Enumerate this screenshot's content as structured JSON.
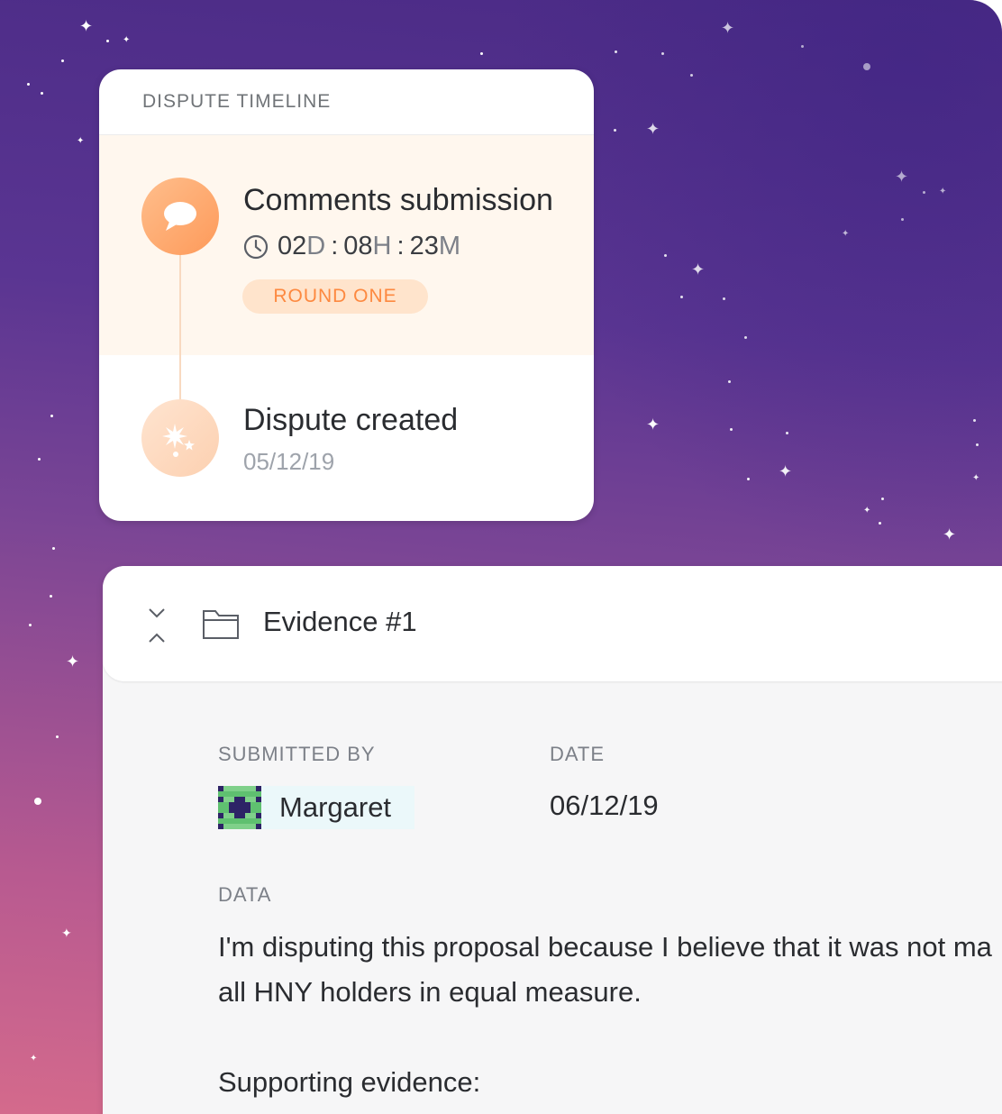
{
  "timeline": {
    "header": "DISPUTE TIMELINE",
    "active_step": {
      "title": "Comments submission",
      "icon": "speech-bubble-icon",
      "timer": {
        "days": "02",
        "days_unit": "D",
        "hours": "08",
        "hours_unit": "H",
        "minutes": "23",
        "minutes_unit": "M",
        "separator": ":"
      },
      "badge": "ROUND ONE"
    },
    "done_step": {
      "title": "Dispute created",
      "icon": "sparkle-icon",
      "date": "05/12/19"
    }
  },
  "evidence": {
    "title": "Evidence #1",
    "submitted_by_label": "SUBMITTED BY",
    "submitter_name": "Margaret",
    "date_label": "DATE",
    "date_value": "06/12/19",
    "data_label": "DATA",
    "body_line1": "I'm disputing this proposal because I believe that it was not ma",
    "body_line2": "all HNY holders in equal measure.",
    "body_line3": "Supporting evidence:"
  },
  "colors": {
    "accent_orange": "#fd8940",
    "active_step_bg": "#fff7ee",
    "background_purple": "#4b2b86",
    "background_pink": "#d46a8c"
  }
}
